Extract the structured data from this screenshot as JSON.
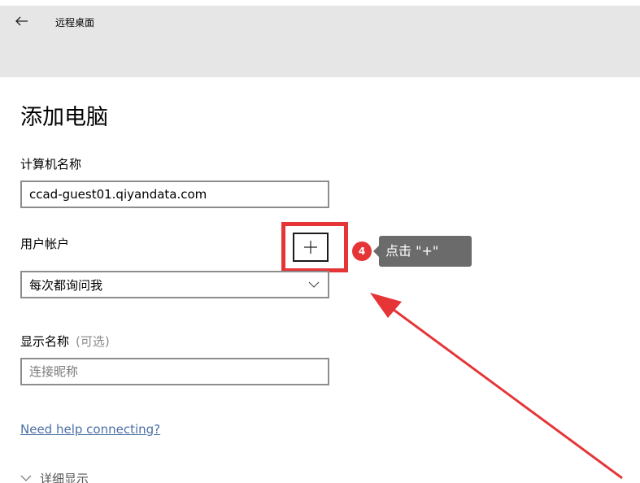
{
  "header": {
    "title": "远程桌面"
  },
  "page": {
    "title": "添加电脑"
  },
  "form": {
    "computer_name_label": "计算机名称",
    "computer_name_value": "ccad-guest01.qiyandata.com",
    "user_account_label": "用户帐户",
    "user_account_selected": "每次都询问我",
    "display_name_label": "显示名称",
    "display_name_optional": "(可选)",
    "display_name_placeholder": "连接昵称",
    "add_button_symbol": "+"
  },
  "annotation": {
    "step_number": "4",
    "tooltip_text": "点击 \"+\"",
    "highlight_color": "#e63537"
  },
  "links": {
    "help": "Need help connecting?"
  },
  "details": {
    "toggle_label": "详细显示"
  },
  "icons": {
    "back": "back-arrow-icon",
    "dropdown": "chevron-down-icon",
    "add": "plus-icon",
    "expand": "chevron-down-icon"
  }
}
